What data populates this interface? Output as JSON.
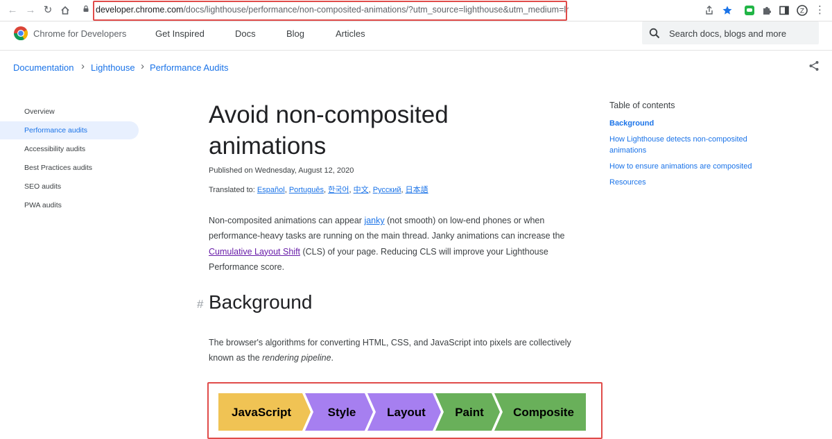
{
  "browser": {
    "url_domain": "developer.chrome.com",
    "url_path": "/docs/lighthouse/performance/non-composited-animations/?utm_source=lighthouse&utm_medium=lr"
  },
  "header": {
    "brand": "Chrome for Developers",
    "nav": [
      "Get Inspired",
      "Docs",
      "Blog",
      "Articles"
    ],
    "search_placeholder": "Search docs, blogs and more"
  },
  "breadcrumb": [
    "Documentation",
    "Lighthouse",
    "Performance Audits"
  ],
  "sidebar": {
    "items": [
      "Overview",
      "Performance audits",
      "Accessibility audits",
      "Best Practices audits",
      "SEO audits",
      "PWA audits"
    ],
    "active_index": 1
  },
  "article": {
    "title": "Avoid non-composited animations",
    "published": "Published on Wednesday, August 12, 2020",
    "translated_prefix": "Translated to:",
    "translations": [
      "Español",
      "Português",
      "한국어",
      "中文",
      "Русский",
      "日本語"
    ],
    "intro": {
      "t1": "Non-composited animations can appear ",
      "link1": "janky",
      "t2": " (not smooth) on low-end phones or when performance-heavy tasks are running on the main thread. Janky animations can increase the ",
      "link2": "Cumulative Layout Shift",
      "t3": " (CLS) of your page. Reducing CLS will improve your Lighthouse Performance score."
    },
    "section_hash": "#",
    "section_title": "Background",
    "background": {
      "t1": "The browser's algorithms for converting HTML, CSS, and JavaScript into pixels are collectively known as the ",
      "em": "rendering pipeline",
      "t2": "."
    },
    "pipeline": [
      {
        "label": "JavaScript",
        "color": "#f0c354"
      },
      {
        "label": "Style",
        "color": "#a67ff0"
      },
      {
        "label": "Layout",
        "color": "#a67ff0"
      },
      {
        "label": "Paint",
        "color": "#69b05a"
      },
      {
        "label": "Composite",
        "color": "#69b05a"
      }
    ]
  },
  "toc": {
    "title": "Table of contents",
    "items": [
      "Background",
      "How Lighthouse detects non-composited animations",
      "How to ensure animations are composited",
      "Resources"
    ]
  },
  "colors": {
    "link": "#1a73e8",
    "visited_link": "#681da8",
    "highlight_box": "#e04b49"
  }
}
